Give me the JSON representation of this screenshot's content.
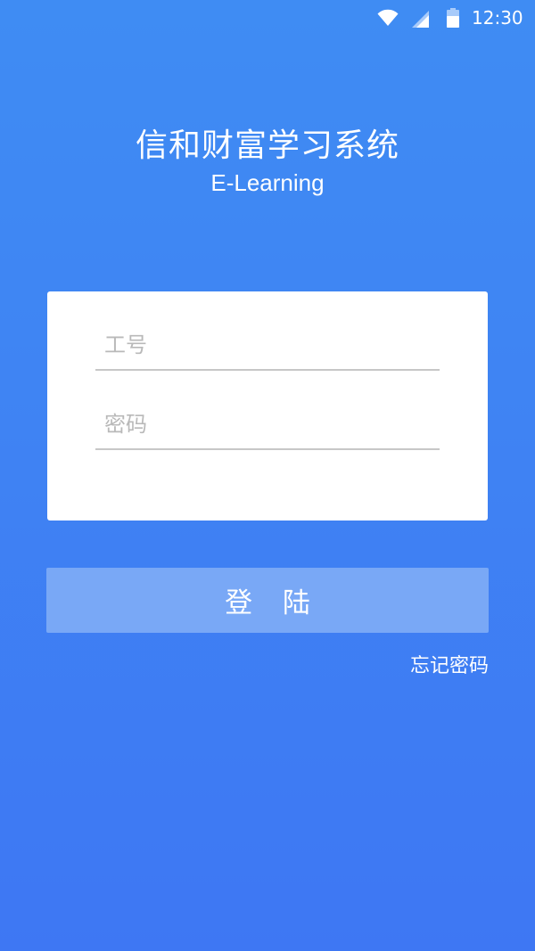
{
  "status_bar": {
    "time": "12:30",
    "icons": [
      "wifi-icon",
      "signal-icon",
      "battery-icon"
    ]
  },
  "header": {
    "title": "信和财富学习系统",
    "subtitle": "E-Learning"
  },
  "login_form": {
    "username": {
      "placeholder": "工号",
      "value": ""
    },
    "password": {
      "placeholder": "密码",
      "value": ""
    },
    "submit_label": "登 陆",
    "forgot_label": "忘记密码"
  },
  "colors": {
    "background_top": "#3f8cf3",
    "background_bottom": "#3e77f3",
    "button": "#79a8f6",
    "card": "#ffffff",
    "underline": "#c7c7c7",
    "placeholder": "#b9b9b9"
  }
}
